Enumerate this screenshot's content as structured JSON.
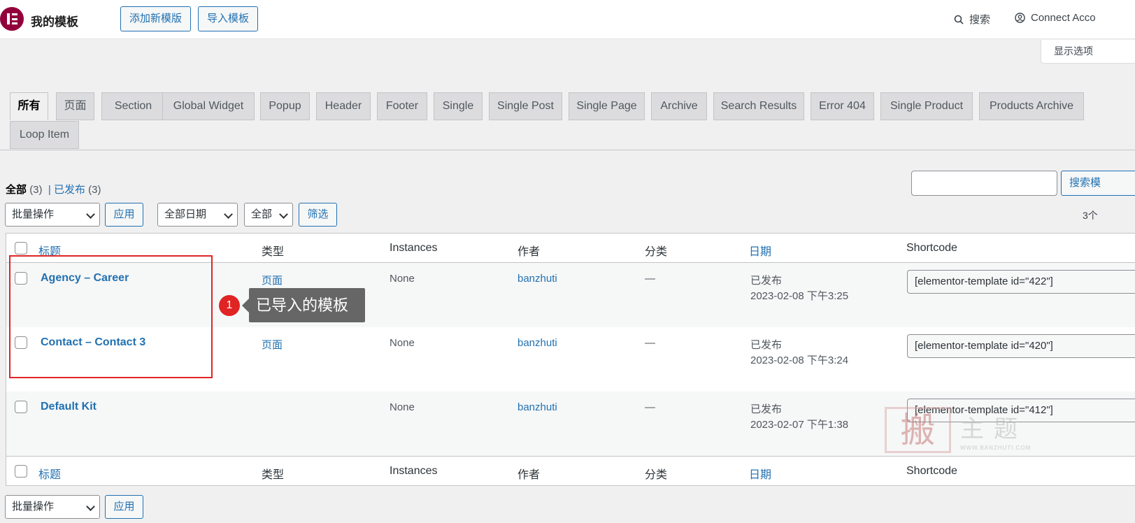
{
  "header": {
    "app_title": "我的模板",
    "add_new_label": "添加新模版",
    "import_label": "导入模板",
    "search_label": "搜索",
    "connect_label": "Connect Acco"
  },
  "screen_options_label": "显示选项",
  "tabs": [
    "所有",
    "页面",
    "Section",
    "Global Widget",
    "Popup",
    "Header",
    "Footer",
    "Single",
    "Single Post",
    "Single Page",
    "Archive",
    "Search Results",
    "Error 404",
    "Single Product",
    "Products Archive",
    "Loop Item"
  ],
  "views": {
    "all_label": "全部",
    "all_count": "(3)",
    "sep": "|",
    "published_label": "已发布",
    "published_count": "(3)"
  },
  "search_button_label": "搜索模",
  "filters": {
    "bulk_action": "批量操作",
    "apply_label": "应用",
    "date_filter": "全部日期",
    "type_filter": "全部",
    "filter_label": "筛选",
    "items_count": "3个"
  },
  "columns": {
    "title": "标题",
    "type": "类型",
    "instances": "Instances",
    "author": "作者",
    "category": "分类",
    "date": "日期",
    "shortcode": "Shortcode"
  },
  "rows": [
    {
      "title": "Agency – Career",
      "type": "页面",
      "instances": "None",
      "author": "banzhuti",
      "category": "—",
      "status": "已发布",
      "date": "2023-02-08 下午3:25",
      "shortcode": "[elementor-template id=\"422\"]"
    },
    {
      "title": "Contact – Contact 3",
      "type": "页面",
      "instances": "None",
      "author": "banzhuti",
      "category": "—",
      "status": "已发布",
      "date": "2023-02-08 下午3:24",
      "shortcode": "[elementor-template id=\"420\"]"
    },
    {
      "title": "Default Kit",
      "type": "",
      "instances": "None",
      "author": "banzhuti",
      "category": "—",
      "status": "已发布",
      "date": "2023-02-07 下午1:38",
      "shortcode": "[elementor-template id=\"412\"]"
    }
  ],
  "annotation": {
    "badge": "1",
    "tooltip": "已导入的模板"
  },
  "watermark": {
    "seal": "搬",
    "text": "主题",
    "url": "WWW.BANZHUTI.COM"
  },
  "footer_controls": {
    "bulk_action": "批量操作",
    "apply_label": "应用"
  }
}
